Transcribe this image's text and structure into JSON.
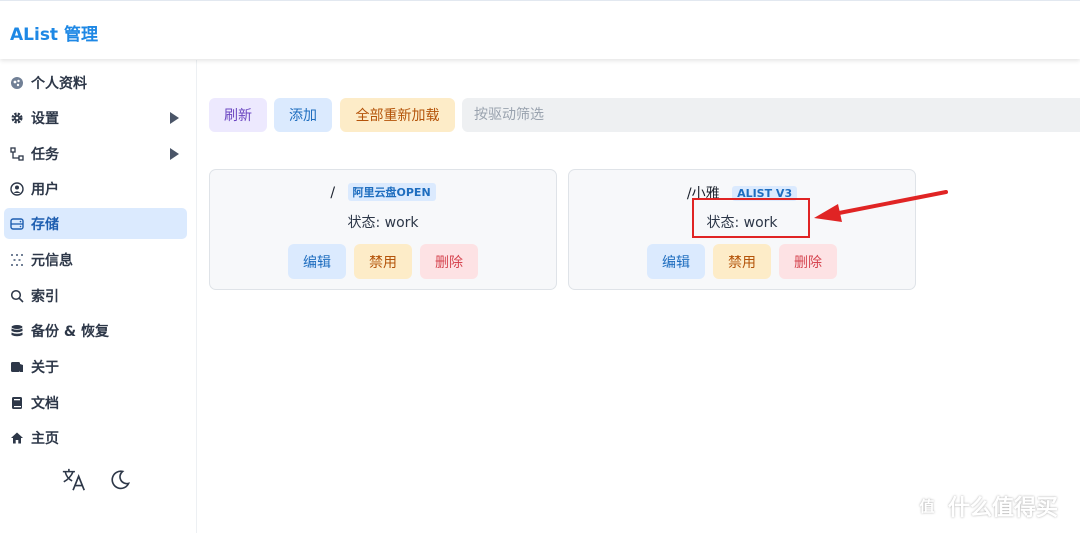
{
  "header": {
    "title": "AList 管理"
  },
  "sidebar": {
    "items": [
      {
        "label": "个人资料",
        "icon": "profile-icon",
        "expandable": false,
        "active": false
      },
      {
        "label": "设置",
        "icon": "gear-icon",
        "expandable": true,
        "active": false
      },
      {
        "label": "任务",
        "icon": "tasks-icon",
        "expandable": true,
        "active": false
      },
      {
        "label": "用户",
        "icon": "user-icon",
        "expandable": false,
        "active": false
      },
      {
        "label": "存储",
        "icon": "storage-icon",
        "expandable": false,
        "active": true
      },
      {
        "label": "元信息",
        "icon": "meta-icon",
        "expandable": false,
        "active": false
      },
      {
        "label": "索引",
        "icon": "search-icon",
        "expandable": false,
        "active": false
      },
      {
        "label": "备份 & 恢复",
        "icon": "database-icon",
        "expandable": false,
        "active": false
      },
      {
        "label": "关于",
        "icon": "about-icon",
        "expandable": false,
        "active": false
      },
      {
        "label": "文档",
        "icon": "book-icon",
        "expandable": false,
        "active": false
      },
      {
        "label": "主页",
        "icon": "home-icon",
        "expandable": false,
        "active": false
      }
    ],
    "bottom_icons": [
      "translate-icon",
      "dark-mode-moon-icon"
    ]
  },
  "toolbar": {
    "refresh_label": "刷新",
    "add_label": "添加",
    "reload_all_label": "全部重新加载",
    "filter_placeholder": "按驱动筛选"
  },
  "storages": [
    {
      "mount_path": "/",
      "driver": "阿里云盘OPEN",
      "status": "状态: work",
      "edit_label": "编辑",
      "disable_label": "禁用",
      "delete_label": "删除"
    },
    {
      "mount_path": "/小雅",
      "driver": "ALIST V3",
      "status": "状态: work",
      "edit_label": "编辑",
      "disable_label": "禁用",
      "delete_label": "删除"
    }
  ],
  "annotation": {
    "color": "#e02424"
  },
  "watermark": {
    "text": "什么值得买",
    "logo_char": "值"
  },
  "colors": {
    "accent": "#1e88e5",
    "active_nav_bg": "#dbeafe",
    "purple_btn_bg": "#ede9fe",
    "blue_btn_bg": "#dbeafe",
    "yellow_btn_bg": "#fdecc8",
    "red_btn_bg": "#fde2e4"
  }
}
